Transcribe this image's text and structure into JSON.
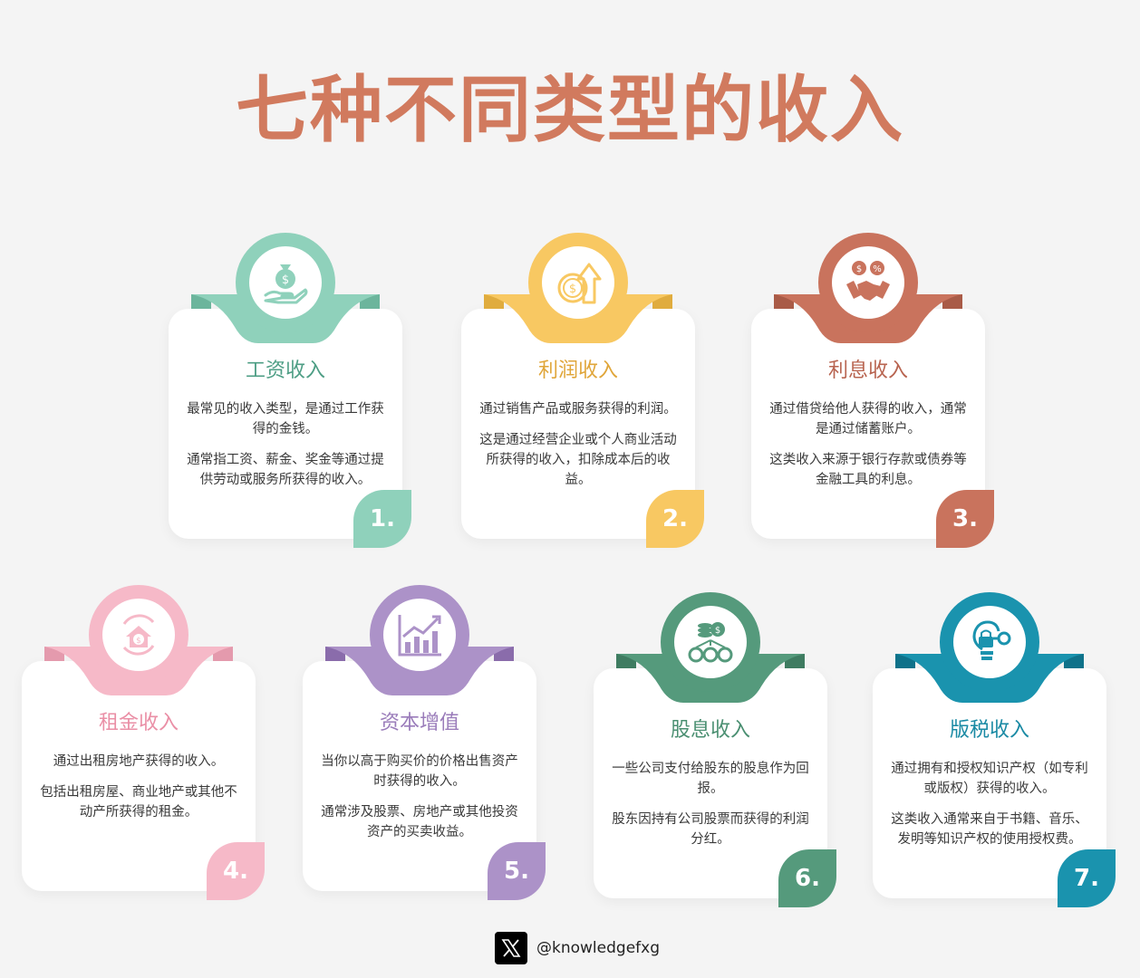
{
  "title": "七种不同类型的收入",
  "cards": [
    {
      "title": "工资收入",
      "p1": "最常见的收入类型，是通过工作获得的金钱。",
      "p2": "通常指工资、薪金、奖金等通过提供劳动或服务所获得的收入。",
      "num": "1.",
      "color": "#8fd1bb",
      "icon": "money-bag-hand-icon"
    },
    {
      "title": "利润收入",
      "p1": "通过销售产品或服务获得的利润。",
      "p2": "这是通过经营企业或个人商业活动所获得的收入，扣除成本后的收益。",
      "num": "2.",
      "color": "#f8c862",
      "icon": "coin-growth-arrow-icon"
    },
    {
      "title": "利息收入",
      "p1": "通过借贷给他人获得的收入，通常是通过储蓄账户。",
      "p2": "这类收入来源于银行存款或债券等金融工具的利息。",
      "num": "3.",
      "color": "#c9735d",
      "icon": "handshake-percent-icon"
    },
    {
      "title": "租金收入",
      "p1": "通过出租房地产获得的收入。",
      "p2": "包括出租房屋、商业地产或其他不动产所获得的租金。",
      "num": "4.",
      "color": "#f6b9c8",
      "icon": "house-cycle-icon"
    },
    {
      "title": "资本增值",
      "p1": "当你以高于购买价的价格出售资产时获得的收入。",
      "p2": "通常涉及股票、房地产或其他投资资产的买卖收益。",
      "num": "5.",
      "color": "#ac92c8",
      "icon": "growth-chart-icon"
    },
    {
      "title": "股息收入",
      "p1": "一些公司支付给股东的股息作为回报。",
      "p2": "股东因持有公司股票而获得的利润分红。",
      "num": "6.",
      "color": "#559a7c",
      "icon": "dividend-distribution-icon"
    },
    {
      "title": "版税收入",
      "p1": "通过拥有和授权知识产权（如专利或版权）获得的收入。",
      "p2": "这类收入通常来自于书籍、音乐、发明等知识产权的使用授权费。",
      "num": "7.",
      "color": "#1a93ae",
      "icon": "bulb-lock-key-icon"
    }
  ],
  "footer": {
    "handle": "@knowledgefxg",
    "icon": "x-logo-icon"
  },
  "colors": {
    "title": "#d17a5e"
  }
}
